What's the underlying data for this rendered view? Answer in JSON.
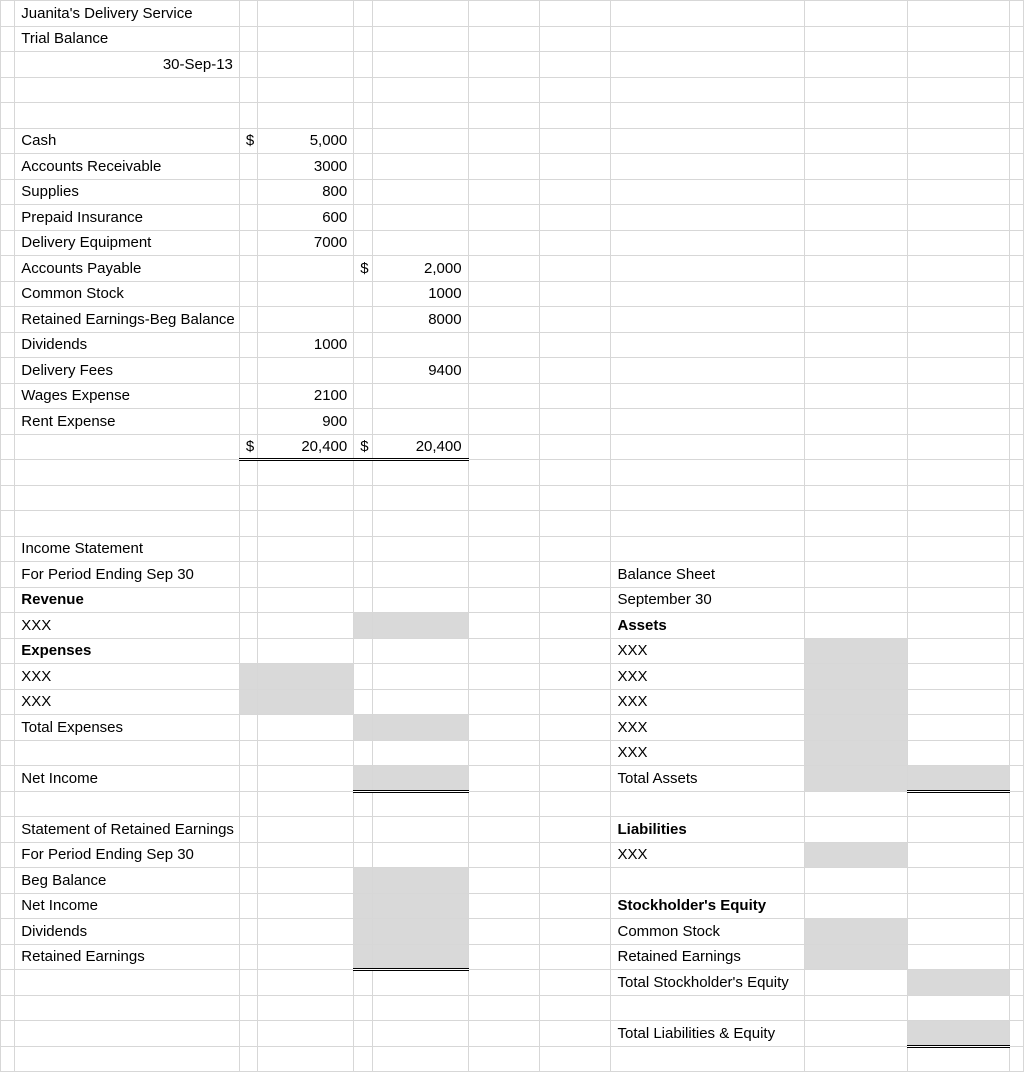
{
  "header": {
    "company": "Juanita's Delivery Service",
    "report": "Trial Balance",
    "date": "30-Sep-13"
  },
  "cur": "$",
  "tb": {
    "cash": {
      "label": "Cash",
      "debit": "5,000"
    },
    "ar": {
      "label": "Accounts Receivable",
      "debit": "3000"
    },
    "supplies": {
      "label": "Supplies",
      "debit": "800"
    },
    "prepaid": {
      "label": "Prepaid Insurance",
      "debit": "600"
    },
    "equip": {
      "label": "Delivery Equipment",
      "debit": "7000"
    },
    "ap": {
      "label": "Accounts Payable",
      "credit": "2,000"
    },
    "cs": {
      "label": "Common Stock",
      "credit": "1000"
    },
    "re_beg": {
      "label": "Retained Earnings-Beg Balance",
      "credit": "8000"
    },
    "div": {
      "label": "Dividends",
      "debit": "1000"
    },
    "fees": {
      "label": "Delivery Fees",
      "credit": "9400"
    },
    "wages": {
      "label": "Wages Expense",
      "debit": "2100"
    },
    "rent": {
      "label": "Rent Expense",
      "debit": "900"
    },
    "total": {
      "debit": "20,400",
      "credit": "20,400"
    }
  },
  "is": {
    "title": "Income Statement",
    "period": "For Period Ending Sep 30",
    "revenue": "Revenue",
    "xxx": "XXX",
    "expenses": "Expenses",
    "totExp": "Total Expenses",
    "netInc": "Net Income"
  },
  "re": {
    "title": "Statement of Retained Earnings",
    "period": "For Period Ending Sep 30",
    "beg": "Beg Balance",
    "net": "Net Income",
    "div": "Dividends",
    "ret": "Retained Earnings"
  },
  "bs": {
    "title": "Balance Sheet",
    "date": "September 30",
    "assets": "Assets",
    "xxx": "XXX",
    "totA": "Total Assets",
    "liab": "Liabilities",
    "se": "Stockholder's Equity",
    "cs": "Common Stock",
    "re": "Retained Earnings",
    "totSE": "Total Stockholder's Equity",
    "totLE": "Total Liabilities & Equity"
  }
}
